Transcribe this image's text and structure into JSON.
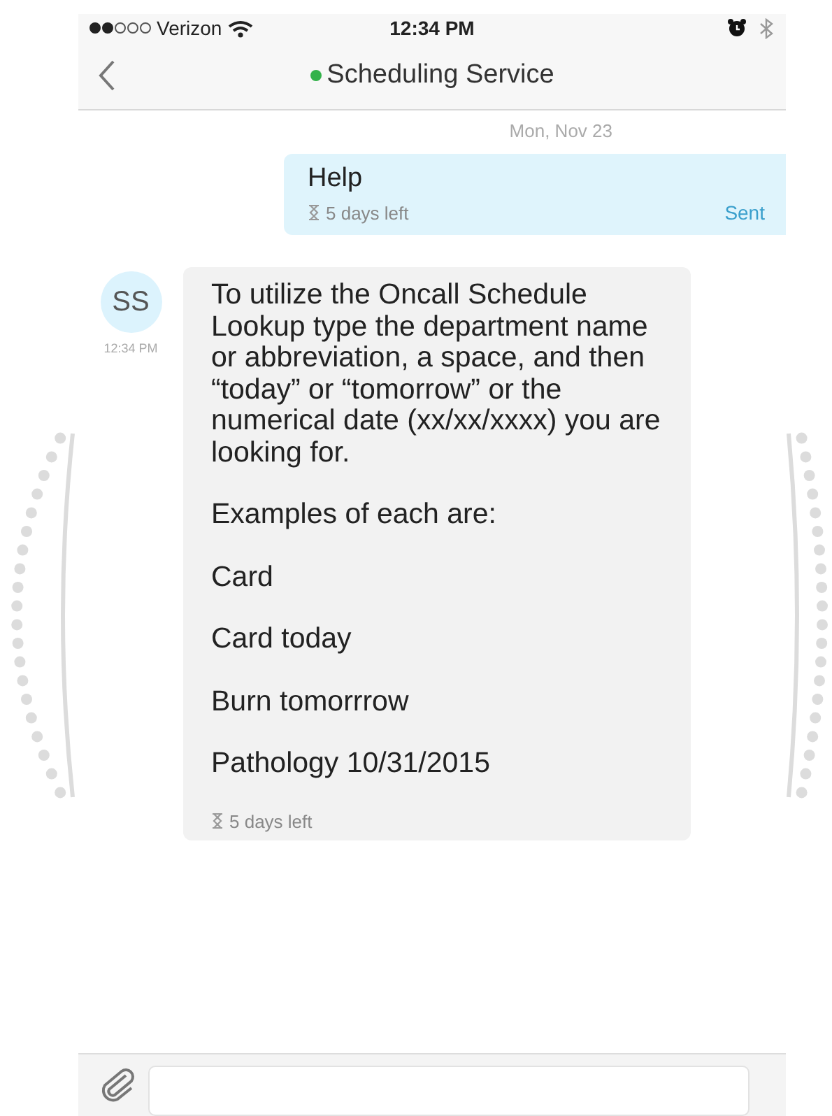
{
  "status_bar": {
    "carrier": "Verizon",
    "time": "12:34 PM"
  },
  "nav": {
    "title": "Scheduling Service",
    "online": true
  },
  "date_divider": "Mon, Nov 23",
  "messages": [
    {
      "kind": "outgoing",
      "text": "Help",
      "expiry": "5 days left",
      "status": "Sent"
    },
    {
      "kind": "incoming",
      "avatar": "SS",
      "time": "12:34 PM",
      "paragraphs": [
        "To utilize the Oncall Schedule Lookup type the department name or abbreviation, a space, and then “today” or “tomorrow” or the numerical date (xx/xx/xxxx) you are looking for.",
        "Examples of each are:",
        "Card",
        "Card today",
        "Burn tomorrrow",
        "Pathology 10/31/2015"
      ],
      "expiry": "5 days left"
    }
  ]
}
